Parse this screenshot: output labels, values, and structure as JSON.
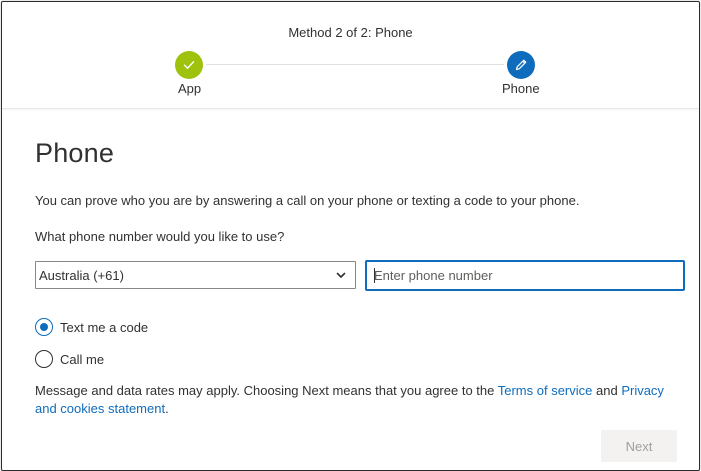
{
  "header": {
    "method_title": "Method 2 of 2: Phone",
    "steps": [
      {
        "label": "App",
        "state": "complete",
        "icon": "check-icon",
        "color": "#9fc20e"
      },
      {
        "label": "Phone",
        "state": "current",
        "icon": "pencil-icon",
        "color": "#0f6cbd"
      }
    ]
  },
  "main": {
    "heading": "Phone",
    "description": "You can prove who you are by answering a call on your phone or texting a code to your phone.",
    "question": "What phone number would you like to use?",
    "country_select": {
      "value": "Australia (+61)"
    },
    "phone_input": {
      "value": "",
      "placeholder": "Enter phone number"
    },
    "options": [
      {
        "label": "Text me a code",
        "checked": true
      },
      {
        "label": "Call me",
        "checked": false
      }
    ],
    "disclaimer": {
      "prefix": "Message and data rates may apply. Choosing Next means that you agree to the ",
      "terms_link": "Terms of service",
      "middle": " and ",
      "privacy_link": "Privacy and cookies statement",
      "suffix": "."
    },
    "next_label": "Next"
  },
  "colors": {
    "accent": "#0f6cbd",
    "success": "#9fc20e",
    "disabled_text": "#a19f9d"
  }
}
